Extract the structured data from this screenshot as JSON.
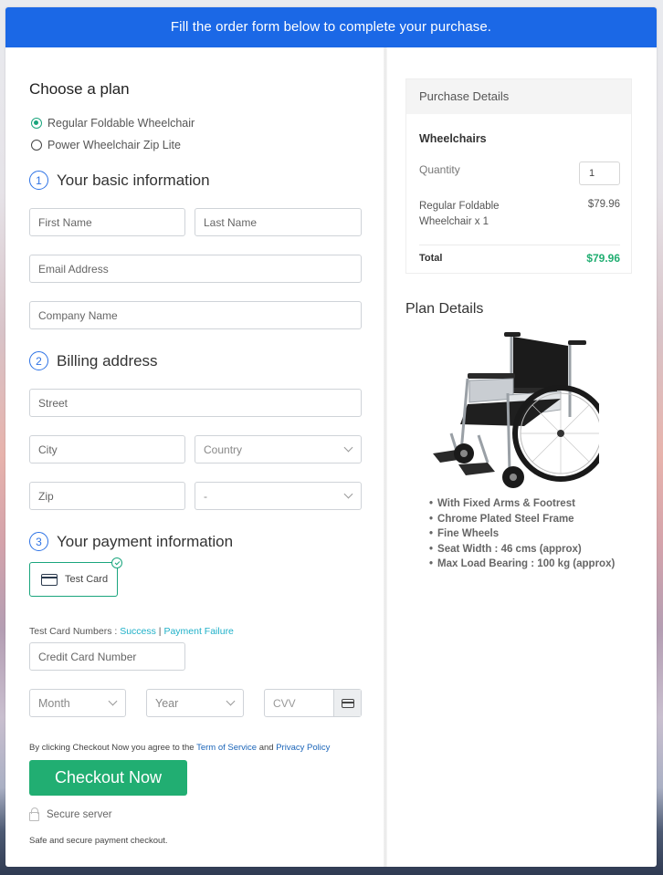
{
  "banner": {
    "text": "Fill the order form below to complete your purchase."
  },
  "plan": {
    "title": "Choose a plan",
    "options": [
      {
        "label": "Regular Foldable Wheelchair",
        "selected": true
      },
      {
        "label": "Power Wheelchair Zip Lite",
        "selected": false
      }
    ]
  },
  "basic_info": {
    "number": "1",
    "title": "Your basic information",
    "first_name_placeholder": "First Name",
    "last_name_placeholder": "Last Name",
    "email_placeholder": "Email Address",
    "company_placeholder": "Company Name"
  },
  "billing": {
    "number": "2",
    "title": "Billing address",
    "street_placeholder": "Street",
    "city_placeholder": "City",
    "country_selected": "Country",
    "zip_placeholder": "Zip",
    "state_selected": "-"
  },
  "payment": {
    "number": "3",
    "title": "Your payment information",
    "method_label": "Test Card",
    "test_numbers_label": "Test Card Numbers : ",
    "success_link": "Success",
    "separator": " | ",
    "failure_link": "Payment Failure",
    "card_number_placeholder": "Credit Card Number",
    "month_selected": "Month",
    "year_selected": "Year",
    "cvv_placeholder": "CVV"
  },
  "agreement": {
    "prefix": "By clicking Checkout Now you agree to the ",
    "terms_link": "Term of Service",
    "middle": " and ",
    "privacy_link": "Privacy Policy"
  },
  "checkout_button": "Checkout Now",
  "secure_label": "Secure server",
  "safe_text": "Safe and secure payment checkout.",
  "purchase_details": {
    "header": "Purchase Details",
    "category": "Wheelchairs",
    "quantity_label": "Quantity",
    "quantity_value": "1",
    "item_name": "Regular Foldable Wheelchair x 1",
    "item_price": "$79.96",
    "total_label": "Total",
    "total_value": "$79.96",
    "total_color": "#21ae72"
  },
  "plan_details": {
    "title": "Plan Details",
    "image_alt": "wheelchair-product-image",
    "features": [
      "With Fixed Arms & Footrest",
      "Chrome Plated Steel Frame",
      "Fine Wheels",
      "Seat Width : 46 cms (approx)",
      "Max Load Bearing : 100 kg (approx)"
    ]
  }
}
